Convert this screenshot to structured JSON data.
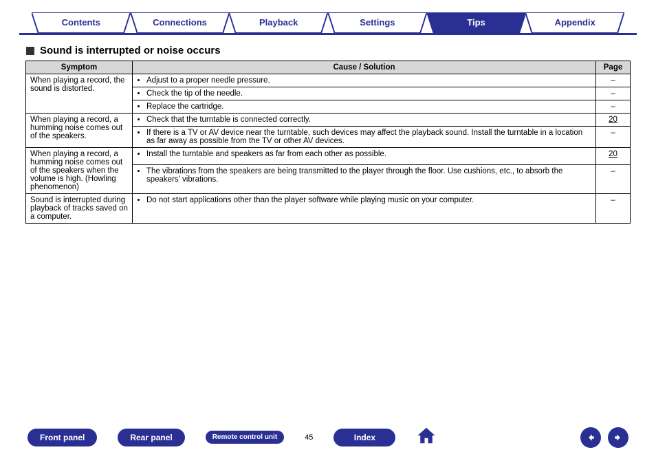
{
  "tabs": [
    {
      "label": "Contents",
      "active": false
    },
    {
      "label": "Connections",
      "active": false
    },
    {
      "label": "Playback",
      "active": false
    },
    {
      "label": "Settings",
      "active": false
    },
    {
      "label": "Tips",
      "active": true
    },
    {
      "label": "Appendix",
      "active": false
    }
  ],
  "heading": "Sound is interrupted or noise occurs",
  "table": {
    "headers": {
      "symptom": "Symptom",
      "cause": "Cause / Solution",
      "page": "Page"
    },
    "rows": [
      {
        "symptom": "When playing a record, the sound is distorted.",
        "solutions": [
          {
            "text": "Adjust to a proper needle pressure.",
            "page": "–"
          },
          {
            "text": "Check the tip of the needle.",
            "page": "–"
          },
          {
            "text": "Replace the cartridge.",
            "page": "–"
          }
        ]
      },
      {
        "symptom": "When playing a record, a humming noise comes out of the speakers.",
        "solutions": [
          {
            "text": "Check that the turntable is connected correctly.",
            "page": "20"
          },
          {
            "text": "If there is a TV or AV device near the turntable, such devices may affect the playback sound. Install the turntable in a location as far away as possible from the TV or other AV devices.",
            "page": "–"
          }
        ]
      },
      {
        "symptom": "When playing a record, a humming noise comes out of the speakers when the volume is high. (Howling phenomenon)",
        "solutions": [
          {
            "text": "Install the turntable and speakers as far from each other as possible.",
            "page": "20"
          },
          {
            "text": "The vibrations from the speakers are being transmitted to the player through the floor. Use cushions, etc., to absorb the speakers' vibrations.",
            "page": "–"
          }
        ]
      },
      {
        "symptom": "Sound is interrupted during playback of tracks saved on a computer.",
        "solutions": [
          {
            "text": "Do not start applications other than the player software while playing music on your computer.",
            "page": "–"
          }
        ]
      }
    ]
  },
  "bottomNav": {
    "front": "Front panel",
    "rear": "Rear panel",
    "remote": "Remote control unit",
    "index": "Index",
    "pageNumber": "45"
  }
}
